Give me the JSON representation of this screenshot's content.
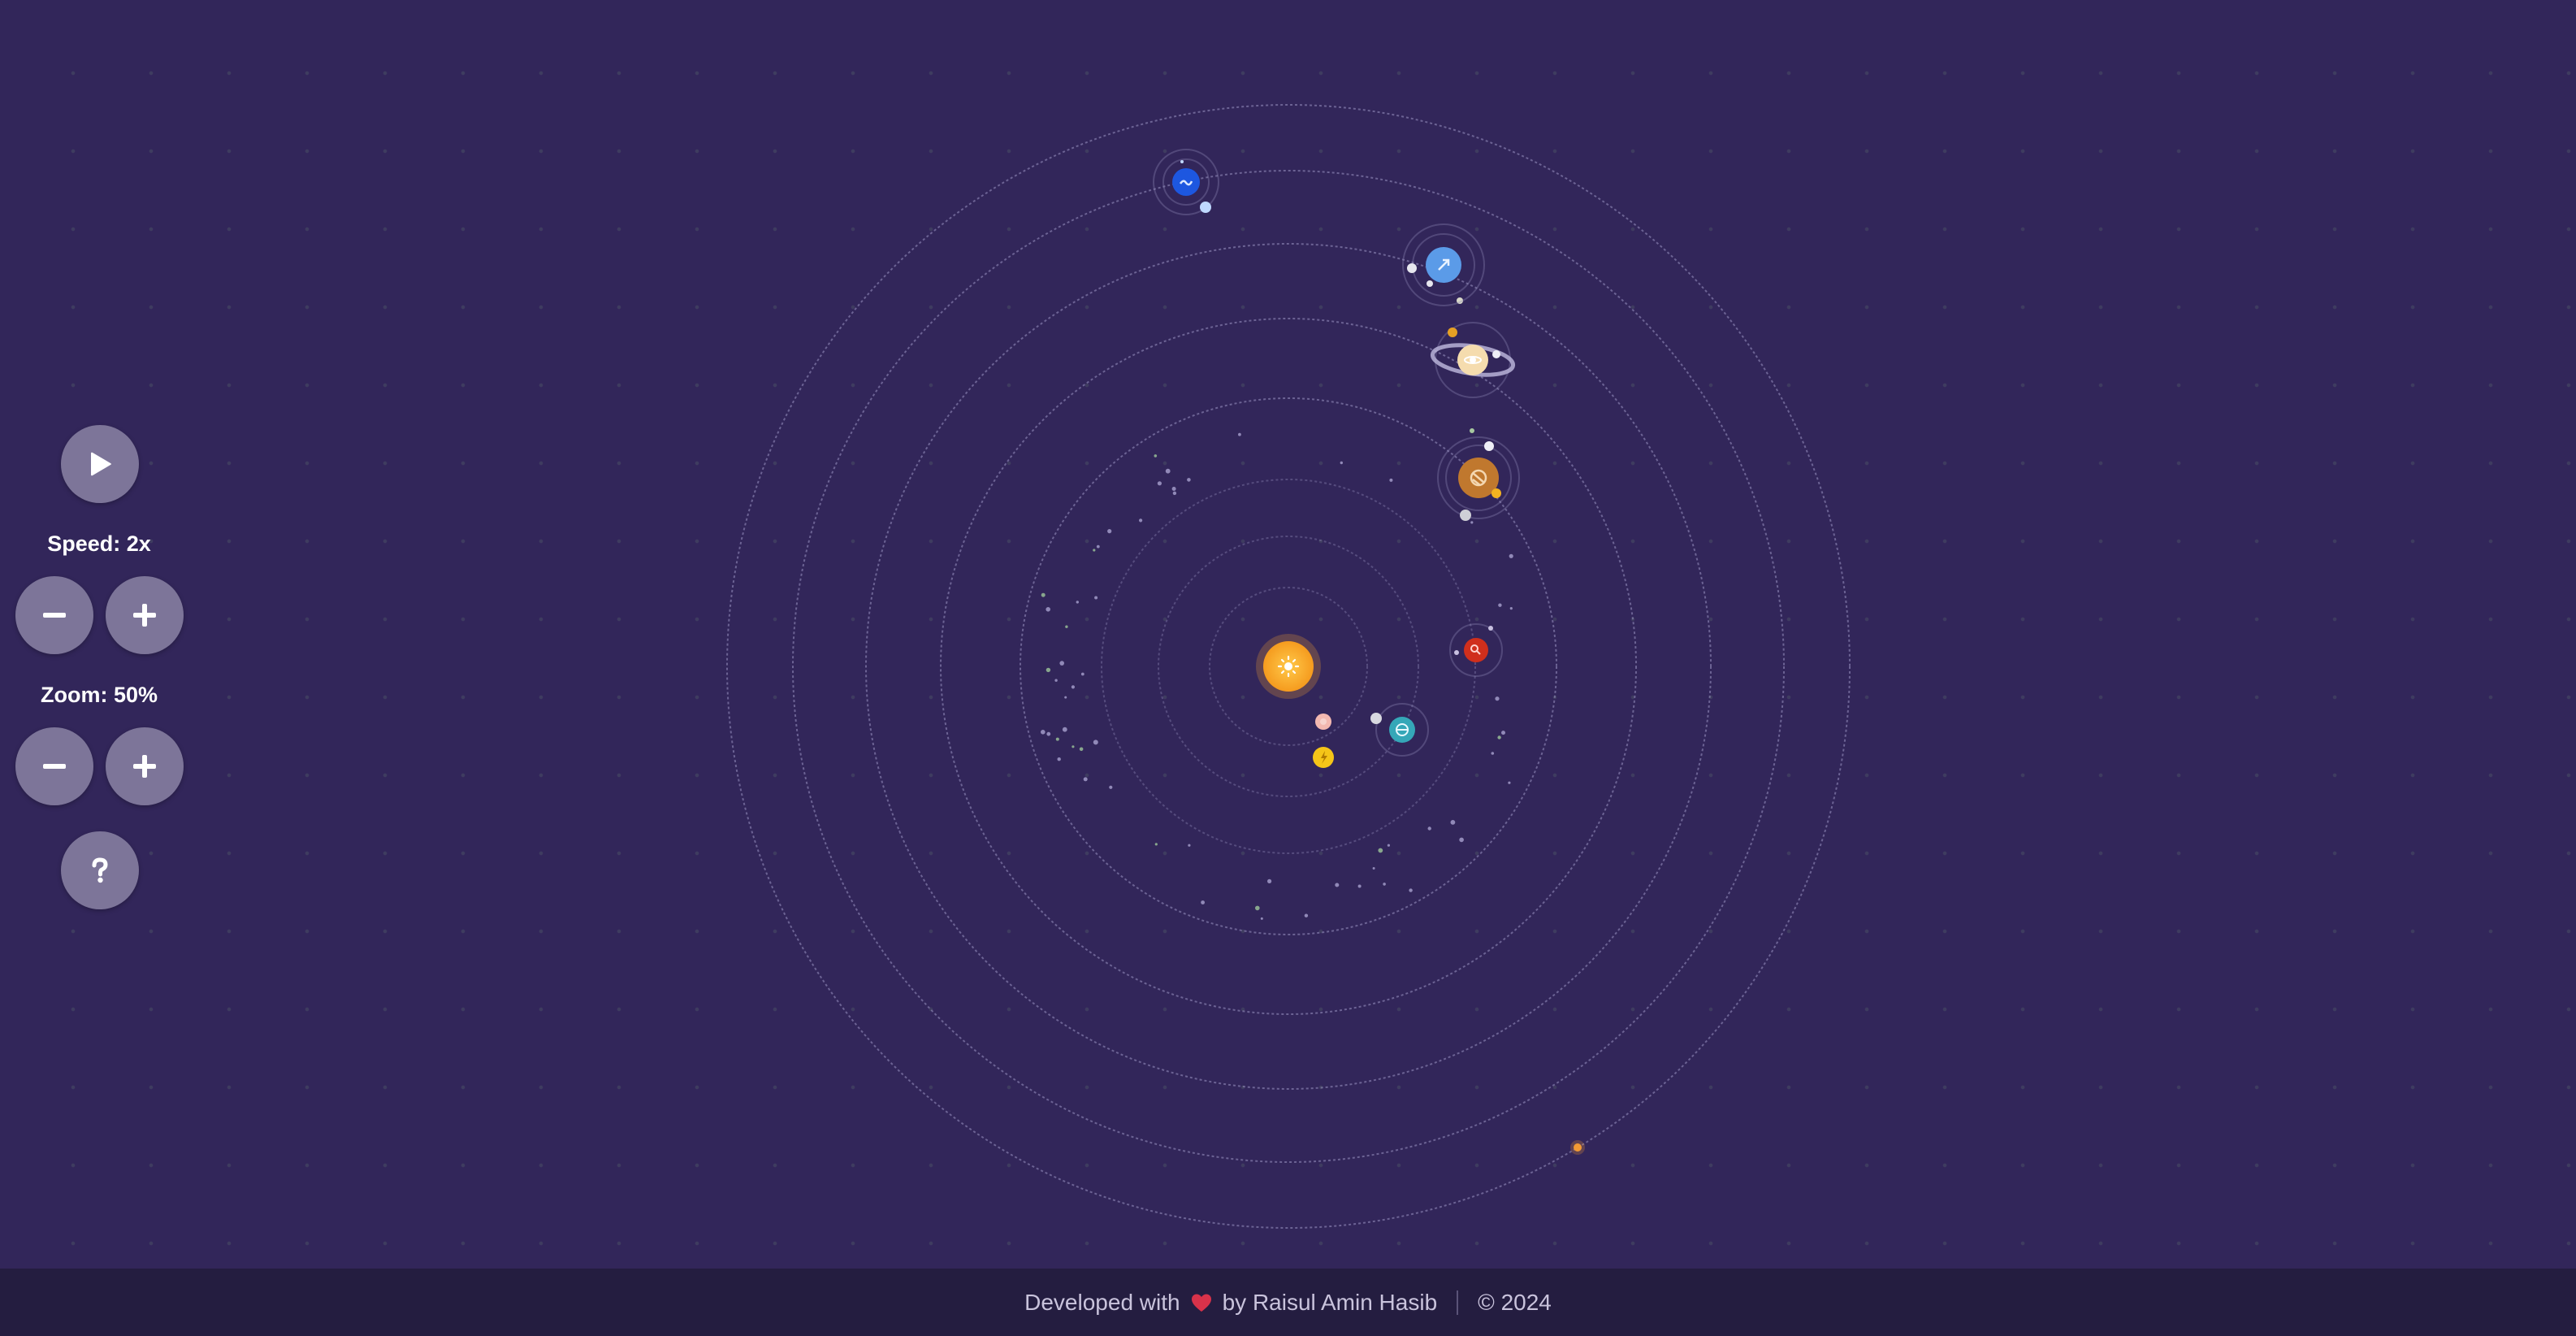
{
  "controls": {
    "play_icon": "play-icon",
    "speed_label": "Speed: 2x",
    "speed_value": 2,
    "zoom_label": "Zoom: 50%",
    "zoom_value": 0.5,
    "decrease_icon": "minus-icon",
    "increase_icon": "plus-icon",
    "help_icon": "question-mark-icon"
  },
  "solar_system": {
    "sun": {
      "icon": "sun-icon",
      "color": "#f7a531"
    },
    "planets": [
      {
        "name": "mercury",
        "color": "#f3b8b0",
        "icon": "small-dot-icon"
      },
      {
        "name": "venus",
        "color": "#f5c518",
        "icon": "lightning-icon"
      },
      {
        "name": "earth",
        "color": "#35a7b8",
        "icon": "earth-icon"
      },
      {
        "name": "mars",
        "color": "#d02f1c",
        "icon": "search-icon"
      },
      {
        "name": "jupiter",
        "color": "#c0782e",
        "icon": "stripes-icon"
      },
      {
        "name": "saturn",
        "color": "#f5dcae",
        "icon": "ringed-planet-icon"
      },
      {
        "name": "uranus",
        "color": "#5b9be8",
        "icon": "arrow-icon"
      },
      {
        "name": "neptune",
        "color": "#1d57e0",
        "icon": "wave-icon"
      }
    ],
    "orbit_color": "#9c95c4"
  },
  "footer": {
    "prefix": "Developed with",
    "heart_icon": "heart-icon",
    "author_text": "by Raisul Amin Hasib",
    "copyright": "© 2024",
    "heart_color": "#d8324a"
  }
}
